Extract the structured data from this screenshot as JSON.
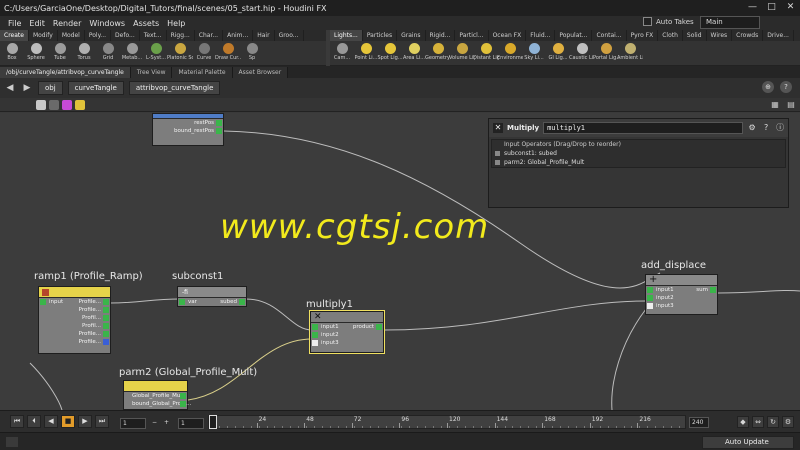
{
  "window": {
    "title": "C:/Users/GarciaOne/Desktop/Digital_Tutors/final/scenes/05_start.hip - Houdini FX",
    "minimize": "—",
    "maximize": "□",
    "close": "✕"
  },
  "menu": [
    "File",
    "Edit",
    "Render",
    "Windows",
    "Assets",
    "Help"
  ],
  "auto_takes_label": "Auto Takes",
  "desktop_select": "Main",
  "shelf_left": {
    "tabs": [
      "Create",
      "Modify",
      "Model",
      "Poly...",
      "Defo...",
      "Text...",
      "Rigg...",
      "Char...",
      "Anim...",
      "Hair",
      "Groo..."
    ],
    "tools": [
      "Box",
      "Sphere",
      "Tube",
      "Torus",
      "Grid",
      "Metab...",
      "L-Syst...",
      "Platonic Sol...",
      "Curve",
      "Draw Cur...",
      "Sp"
    ]
  },
  "shelf_right": {
    "tabs": [
      "Lights...",
      "Particles",
      "Grains",
      "Rigid...",
      "Particl...",
      "Ocean FX",
      "Fluid...",
      "Populat...",
      "Contai...",
      "Pyro FX",
      "Cloth",
      "Solid",
      "Wires",
      "Crowds",
      "Drive..."
    ],
    "tools": [
      "Cam...",
      "Point Li...",
      "Spot Lig...",
      "Area Li...",
      "Geometry L...",
      "Volume Lig...",
      "Distant Lig...",
      "Environme...",
      "Sky Li...",
      "GI Lig...",
      "Caustic Li...",
      "Portal Lig...",
      "Ambient Lig..."
    ]
  },
  "pane_tabs": [
    "/obj/curveTangle/attribvop_curveTangle",
    "Tree View",
    "Material Palette",
    "Asset Browser"
  ],
  "path": [
    "obj",
    "curveTangle",
    "attribvop_curveTangle"
  ],
  "nodes": {
    "top_node": {
      "rows": [
        "restPos",
        "bound_restPos"
      ]
    },
    "ramp1": {
      "label": "ramp1 (Profile_Ramp)",
      "input": "input",
      "outputs": [
        "Profile...",
        "Profile...",
        "Profil...",
        "Profil...",
        "Profile...",
        "Profile..."
      ]
    },
    "subconst1": {
      "label": "subconst1",
      "header": "-fi",
      "input": "var",
      "output": "subed"
    },
    "multiply1": {
      "label": "multiply1",
      "inputs": [
        "input1",
        "input2",
        "input3"
      ],
      "output": "product"
    },
    "parm2": {
      "label": "parm2 (Global_Profile_Mult)",
      "rows": [
        "Global_Profile_Mult",
        "bound_Global_Profil..."
      ]
    },
    "add_displace": {
      "label": "add_displace",
      "inputs": [
        "input1",
        "input2",
        "input3"
      ],
      "output": "sum"
    }
  },
  "inspector": {
    "type": "Multiply",
    "name": "multiply1",
    "list_header": "Input Operators (Drag/Drop to reorder)",
    "items": [
      "subconst1: subed",
      "parm2: Global_Profile_Mult"
    ]
  },
  "watermark": "www.cgtsj.com",
  "timeline": {
    "ticks": [
      "1",
      "24",
      "48",
      "72",
      "96",
      "120",
      "144",
      "168",
      "192",
      "216"
    ],
    "end_frame": "240",
    "start_field": "1",
    "current_field": "1",
    "step_field": "1"
  },
  "status": {
    "auto_update": "Auto Update"
  },
  "colors": {
    "accent_yellow": "#e6d34a",
    "port_green": "#3ab54a",
    "watermark": "#f2ea1c"
  }
}
